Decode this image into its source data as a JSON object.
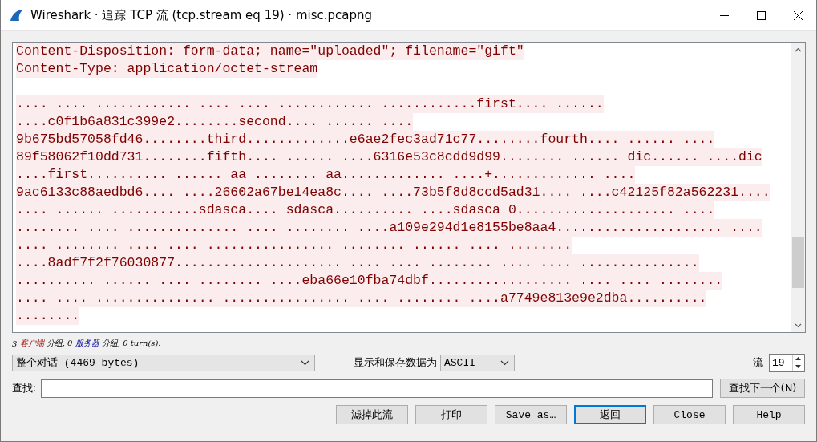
{
  "window": {
    "title": "Wireshark · 追踪 TCP 流 (tcp.stream eq 19) · misc.pcapng"
  },
  "stream_lines": [
    {
      "kind": "client",
      "text": "Content-Disposition: form-data; name=\"uploaded\"; filename=\"gift\""
    },
    {
      "kind": "client",
      "text": "Content-Type: application/octet-stream"
    },
    {
      "kind": "blank"
    },
    {
      "kind": "client",
      "text": ".... .... ............ .... .... ............ ............first.... ......"
    },
    {
      "kind": "client",
      "text": "....c0f1b6a831c399e2........second.... ...... ...."
    },
    {
      "kind": "client",
      "text": "9b675bd57058fd46........third.............e6ae2fec3ad71c77........fourth.... ...... ...."
    },
    {
      "kind": "client",
      "text": "89f58062f10dd731........fifth.... ...... ....6316e53c8cdd9d99........ ...... dic...... ....dic"
    },
    {
      "kind": "client",
      "text": "....first.......... ...... aa ........ aa............. ....+............. ...."
    },
    {
      "kind": "client",
      "text": "9ac6133c88aedbd6.... ....26602a67be14ea8c.... ....73b5f8d8ccd5ad31.... ....c42125f82a562231...."
    },
    {
      "kind": "client",
      "text": ".... ...... ...........sdasca.... sdasca.......... ....sdasca 0.................... ...."
    },
    {
      "kind": "client",
      "text": "........ .... .............. .... ........ ....a109e294d1e8155be8aa4..................... ...."
    },
    {
      "kind": "client",
      "text": ".... ........ .... .... ................ ........ ...... .... ........"
    },
    {
      "kind": "client",
      "text": "....8adf7f2f76030877..................... .... .... ........ .... .... ..............."
    },
    {
      "kind": "client",
      "text": ".......... ...... .... ........ ....eba66e10fba74dbf.................. .... .... ........"
    },
    {
      "kind": "client",
      "text": ".... .... ............... ................ .... ........ ....a7749e813e9e2dba.........."
    },
    {
      "kind": "client",
      "text": "........"
    }
  ],
  "summary": {
    "client_count": "3",
    "client_label": "客户端",
    "client_unit": "分组,",
    "server_count": "0",
    "server_label": "服务器",
    "server_unit": "分组,",
    "turns": "0 turn(s)."
  },
  "conversation_select": {
    "value": "整个对话 (4469 bytes)"
  },
  "format_label": "显示和保存数据为",
  "format_select": {
    "value": "ASCII"
  },
  "stream_label": "流",
  "stream_spin": {
    "value": "19"
  },
  "find": {
    "label": "查找:",
    "button": "查找下一个(N)"
  },
  "buttons": [
    {
      "label": "滤掉此流",
      "default": false
    },
    {
      "label": "打印",
      "default": false
    },
    {
      "label": "Save as…",
      "default": false
    },
    {
      "label": "返回",
      "default": true
    },
    {
      "label": "Close",
      "default": false
    },
    {
      "label": "Help",
      "default": false
    }
  ]
}
